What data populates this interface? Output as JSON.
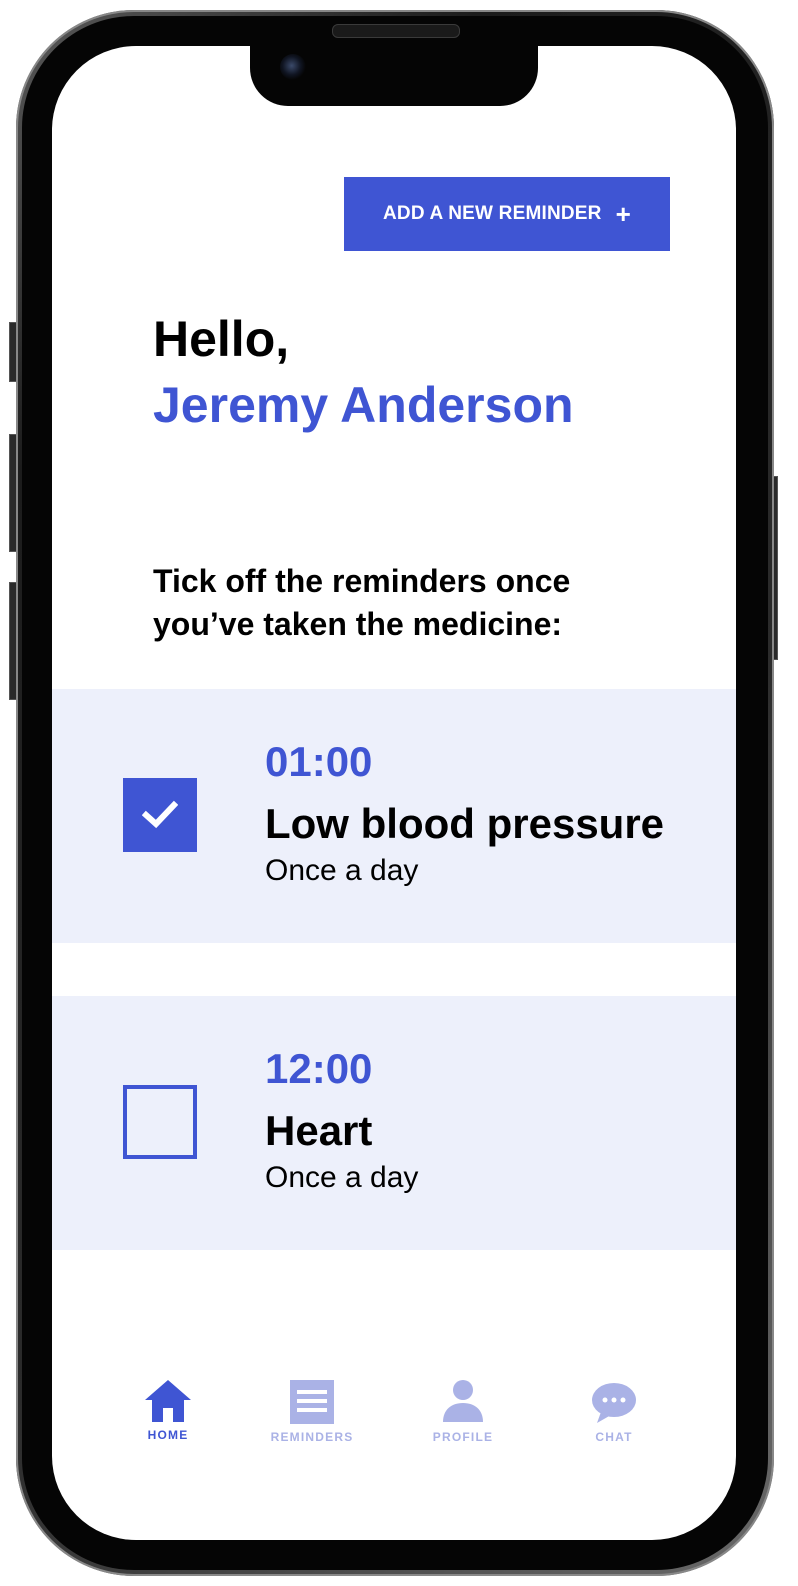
{
  "colors": {
    "accent": "#3f55d3",
    "card_background": "#edf0fb",
    "inactive_tab": "#aab2e6",
    "text": "#000000"
  },
  "header": {
    "add_button_label": "ADD A NEW REMINDER",
    "add_button_icon": "plus-icon"
  },
  "greeting": {
    "hello": "Hello,",
    "name": "Jeremy Anderson"
  },
  "instruction": "Tick off the reminders once you’ve taken the medicine:",
  "reminders": [
    {
      "time": "01:00",
      "medicine": "Low blood pressure",
      "frequency": "Once a day",
      "checked": true
    },
    {
      "time": "12:00",
      "medicine": "Heart",
      "frequency": "Once a day",
      "checked": false
    }
  ],
  "tabbar": {
    "items": [
      {
        "label": "HOME",
        "icon": "home-icon",
        "active": true
      },
      {
        "label": "REMINDERS",
        "icon": "list-icon",
        "active": false
      },
      {
        "label": "PROFILE",
        "icon": "person-icon",
        "active": false
      },
      {
        "label": "CHAT",
        "icon": "chat-bubble-icon",
        "active": false
      }
    ]
  }
}
